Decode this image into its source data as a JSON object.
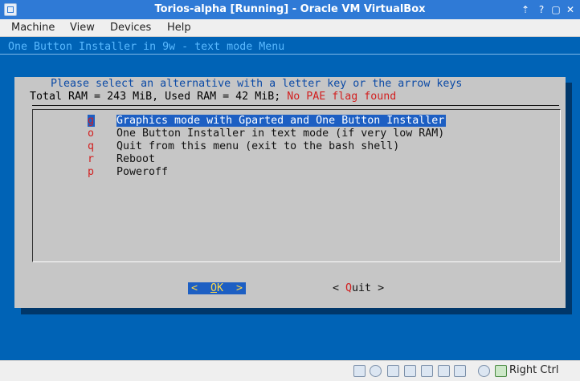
{
  "window": {
    "title": "Torios-alpha [Running] - Oracle VM VirtualBox",
    "controls": {
      "help": "?",
      "maximize": "▢",
      "close": "✕",
      "up": "⇡"
    }
  },
  "menubar": {
    "items": [
      "Machine",
      "View",
      "Devices",
      "Help"
    ]
  },
  "vm": {
    "backtitle": "One Button Installer in 9w - text mode Menu",
    "dialog": {
      "prompt": "Please select an alternative with a letter key or the arrow keys",
      "ram_info": "Total RAM = 243 MiB, Used RAM = 42 MiB; ",
      "ram_warning": "No PAE flag found",
      "items": [
        {
          "key": "g",
          "label": "Graphics mode with Gparted and One Button Installer",
          "selected": true
        },
        {
          "key": "o",
          "label": "One Button Installer in text mode (if very low RAM)",
          "selected": false
        },
        {
          "key": "q",
          "label": "Quit from this menu (exit to the bash shell)",
          "selected": false
        },
        {
          "key": "r",
          "label": "Reboot",
          "selected": false
        },
        {
          "key": "p",
          "label": "Poweroff",
          "selected": false
        }
      ],
      "ok_button": {
        "left": "<",
        "hot": "O",
        "rest": "K",
        "right": ">"
      },
      "quit_button": {
        "left": "< ",
        "hot": "Q",
        "rest": "uit",
        "right": " >"
      }
    }
  },
  "statusbar": {
    "icons": [
      "hard-disk-icon",
      "optical-drive-icon",
      "usb-icon",
      "network-icon",
      "shared-folders-icon",
      "display-icon",
      "video-capture-icon",
      "cpu-icon",
      "mouse-integration-icon",
      "keyboard-capture-icon"
    ],
    "host_key": "Right Ctrl"
  },
  "colors": {
    "titlebar": "#2f7ad6",
    "vm_background": "#0063b6",
    "dialog": "#c6c6c6",
    "highlight": "#1d5fc3",
    "hotkey": "#d21f1f"
  }
}
